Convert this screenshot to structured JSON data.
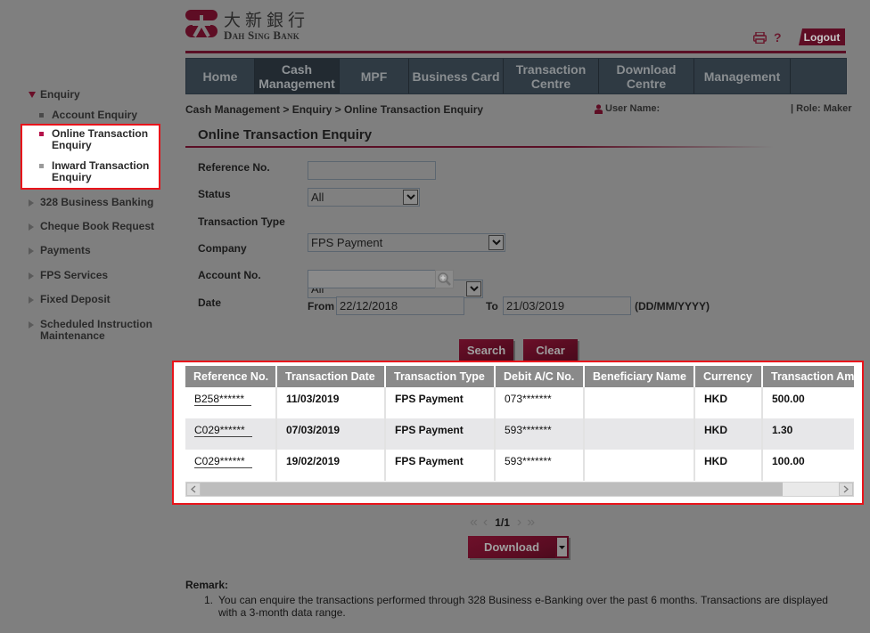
{
  "header": {
    "logo_cn": "大新銀行",
    "logo_en": "Dah Sing Bank",
    "print_icon": "printer-icon",
    "help_label": "?",
    "logout_label": "Logout"
  },
  "nav": {
    "tabs": [
      {
        "label": "Home",
        "active": false
      },
      {
        "label": "Cash Management",
        "active": true
      },
      {
        "label": "MPF",
        "active": false
      },
      {
        "label": "Business Card",
        "active": false
      },
      {
        "label": "Transaction Centre",
        "active": false
      },
      {
        "label": "Download Centre",
        "active": false
      },
      {
        "label": "Management",
        "active": false
      }
    ]
  },
  "breadcrumb": "Cash Management > Enquiry > Online Transaction Enquiry",
  "user": {
    "user_name_label": "User Name:",
    "role_label": "| Role: Maker"
  },
  "page_title": "Online Transaction Enquiry",
  "sidebar": {
    "section": "Enquiry",
    "sub_items": [
      {
        "label": "Account Enquiry",
        "active": false
      },
      {
        "label": "Online Transaction Enquiry",
        "active": true
      },
      {
        "label": "Inward Transaction Enquiry",
        "active": false
      }
    ],
    "items": [
      {
        "label": "328 Business Banking"
      },
      {
        "label": "Cheque Book Request"
      },
      {
        "label": "Payments"
      },
      {
        "label": "FPS Services"
      },
      {
        "label": "Fixed Deposit"
      },
      {
        "label": "Scheduled Instruction Maintenance"
      }
    ]
  },
  "form": {
    "reference_no": {
      "label": "Reference No.",
      "value": ""
    },
    "status": {
      "label": "Status",
      "value": "All"
    },
    "transaction_type": {
      "label": "Transaction Type",
      "value": "FPS Payment"
    },
    "company": {
      "label": "Company",
      "value": "All"
    },
    "account_no": {
      "label": "Account No.",
      "value": ""
    },
    "date": {
      "label": "Date",
      "from_label": "From",
      "from_value": "22/12/2018",
      "to_label": "To",
      "to_value": "21/03/2019",
      "format_hint": "(DD/MM/YYYY)"
    },
    "search_label": "Search",
    "clear_label": "Clear"
  },
  "results": {
    "columns": [
      "Reference No.",
      "Transaction Date",
      "Transaction Type",
      "Debit A/C No.",
      "Beneficiary Name",
      "Currency",
      "Transaction Amount"
    ],
    "rows": [
      {
        "reference": "B258******",
        "date": "11/03/2019",
        "type": "FPS Payment",
        "debit_ac": "073*******",
        "beneficiary": "",
        "currency": "HKD",
        "amount": "500.00"
      },
      {
        "reference": "C029******",
        "date": "07/03/2019",
        "type": "FPS Payment",
        "debit_ac": "593*******",
        "beneficiary": "",
        "currency": "HKD",
        "amount": "1.30"
      },
      {
        "reference": "C029******",
        "date": "19/02/2019",
        "type": "FPS Payment",
        "debit_ac": "593*******",
        "beneficiary": "",
        "currency": "HKD",
        "amount": "100.00"
      }
    ]
  },
  "pagination": {
    "first": "«",
    "prev": "‹",
    "page_display": "1/1",
    "next": "›",
    "last": "»"
  },
  "download_label": "Download",
  "remark": {
    "title": "Remark:",
    "items": [
      {
        "num": "1.",
        "text": "You can enquire the transactions performed through 328 Business e-Banking over the past 6 months. Transactions are displayed with a 3-month data range."
      }
    ]
  },
  "colors": {
    "brand": "#5e0d24",
    "nav_bg": "#2f3a43",
    "highlight_border": "#e8141b",
    "overlay": "#7f7f7f"
  }
}
